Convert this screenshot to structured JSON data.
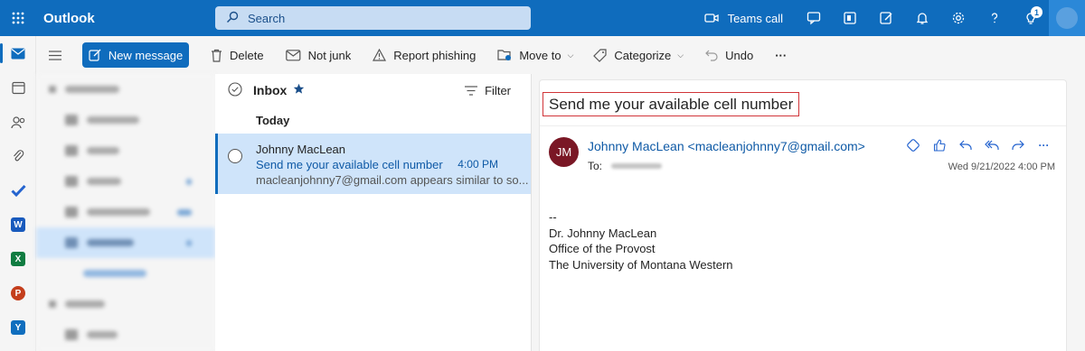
{
  "app": {
    "title": "Outlook"
  },
  "search": {
    "placeholder": "Search"
  },
  "topbar": {
    "teams_call": "Teams call",
    "notification_count": "1"
  },
  "toolbar": {
    "new_message": "New message",
    "delete": "Delete",
    "not_junk": "Not junk",
    "report_phishing": "Report phishing",
    "move_to": "Move to",
    "categorize": "Categorize",
    "undo": "Undo",
    "more": "···"
  },
  "message_list": {
    "folder_title": "Inbox",
    "filter": "Filter",
    "group": "Today",
    "items": [
      {
        "sender": "Johnny MacLean",
        "subject": "Send me your available cell number",
        "time": "4:00 PM",
        "preview": "macleanjohnny7@gmail.com appears similar to so..."
      }
    ]
  },
  "reading_pane": {
    "subject": "Send me your available cell number",
    "sender_initials": "JM",
    "from": "Johnny MacLean <macleanjohnny7@gmail.com>",
    "to_label": "To:",
    "date": "Wed 9/21/2022 4:00 PM",
    "more": "···",
    "body_lines": [
      "--",
      "Dr. Johnny MacLean",
      "Office of the Provost",
      "The University of Montana Western"
    ]
  },
  "colors": {
    "brand": "#0f6cbd",
    "selected_row": "#cfe4fa",
    "highlight_border": "#d13438",
    "avatar": "#7a1725"
  }
}
